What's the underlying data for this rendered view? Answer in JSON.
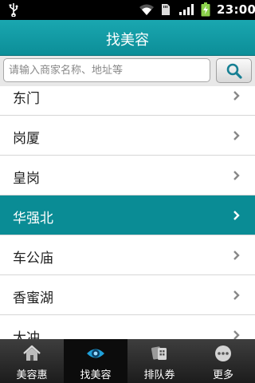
{
  "status_bar": {
    "time": "23:00"
  },
  "header": {
    "title": "找美容"
  },
  "search": {
    "placeholder": "请输入商家名称、地址等"
  },
  "district_list": [
    {
      "label": "东门",
      "selected": false
    },
    {
      "label": "岗厦",
      "selected": false
    },
    {
      "label": "皇岗",
      "selected": false
    },
    {
      "label": "华强北",
      "selected": true
    },
    {
      "label": "车公庙",
      "selected": false
    },
    {
      "label": "香蜜湖",
      "selected": false
    },
    {
      "label": "大冲",
      "selected": false
    }
  ],
  "tabs": [
    {
      "label": "美容惠",
      "icon": "house-icon",
      "active": false
    },
    {
      "label": "找美容",
      "icon": "eye-icon",
      "active": true
    },
    {
      "label": "排队券",
      "icon": "cards-icon",
      "active": false
    },
    {
      "label": "更多",
      "icon": "more-icon",
      "active": false
    }
  ],
  "colors": {
    "accent": "#0a8c95",
    "status_bar": "#000000",
    "tab_bar": "#2a2a2a"
  }
}
